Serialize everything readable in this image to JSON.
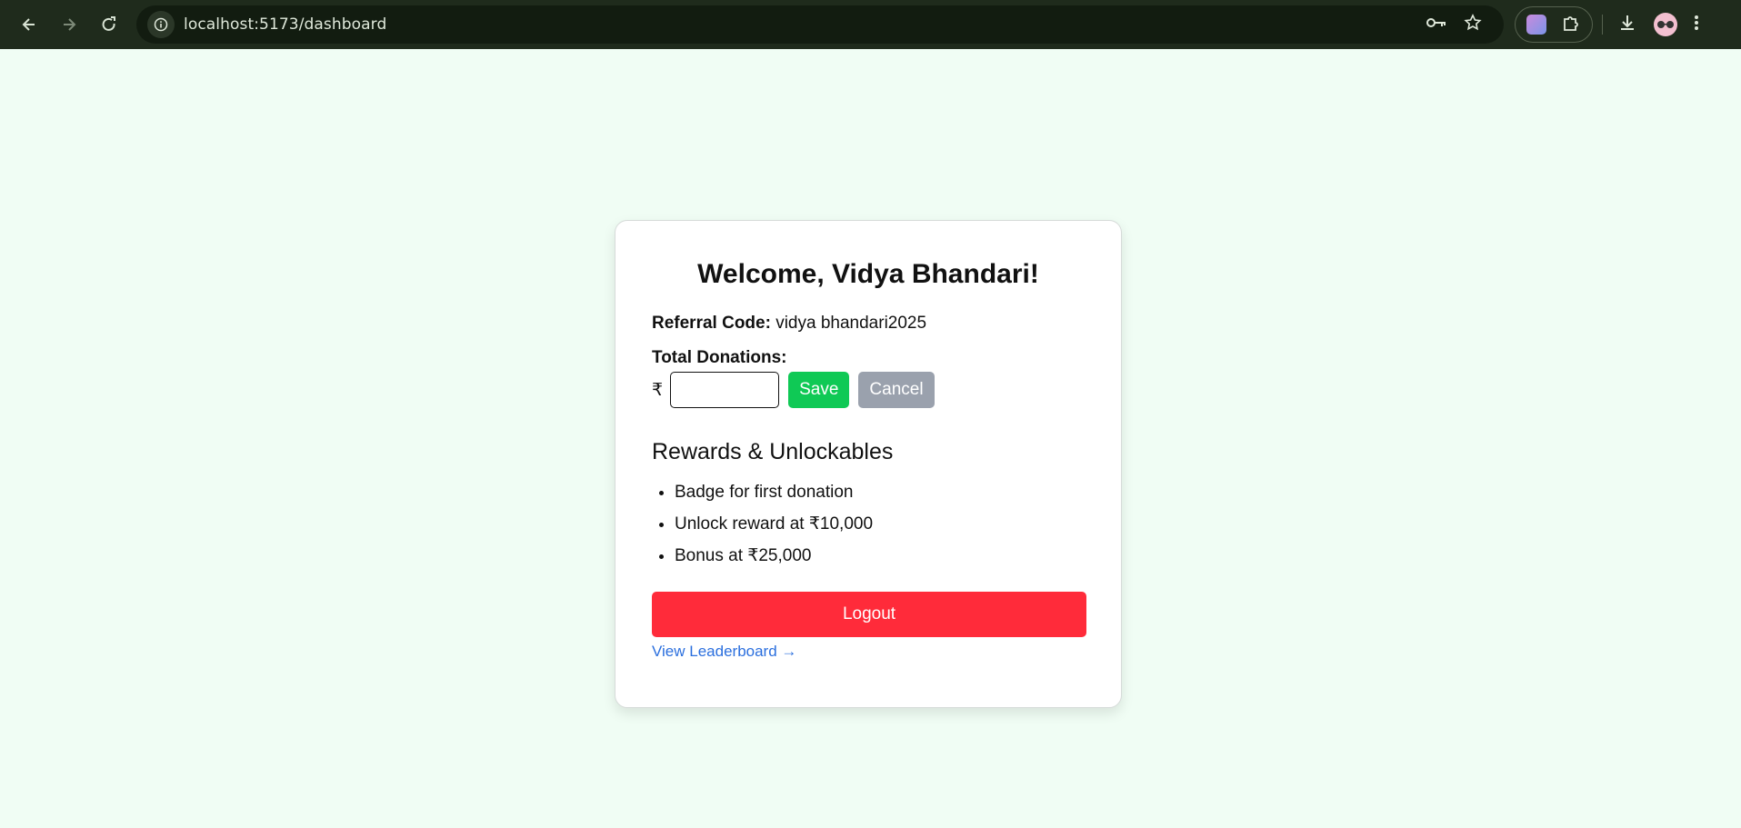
{
  "browser": {
    "url": "localhost:5173/dashboard",
    "icons": [
      "back-arrow-icon",
      "forward-arrow-icon",
      "reload-icon",
      "site-info-icon",
      "password-key-icon",
      "bookmark-star-icon",
      "extension-icon",
      "puzzle-icon",
      "download-icon",
      "profile-avatar-icon",
      "menu-kebab-icon"
    ]
  },
  "dashboard": {
    "welcome": "Welcome, Vidya Bhandari!",
    "referral_label": "Referral Code:",
    "referral_value": "vidya bhandari2025",
    "total_label": "Total Donations:",
    "currency_symbol": "₹",
    "amount_value": "",
    "save_label": "Save",
    "cancel_label": "Cancel",
    "rewards_title": "Rewards & Unlockables",
    "rewards": [
      "Badge for first donation",
      "Unlock reward at ₹10,000",
      "Bonus at ₹25,000"
    ],
    "logout_label": "Logout",
    "leaderboard_link": "View Leaderboard →"
  },
  "colors": {
    "page_bg": "#f0fdf4",
    "save_bg": "#0fc955",
    "cancel_bg": "#9aa1ad",
    "logout_bg": "#ff2b3a",
    "link": "#2b6fde",
    "toolbar_bg": "#1f2b1c"
  }
}
